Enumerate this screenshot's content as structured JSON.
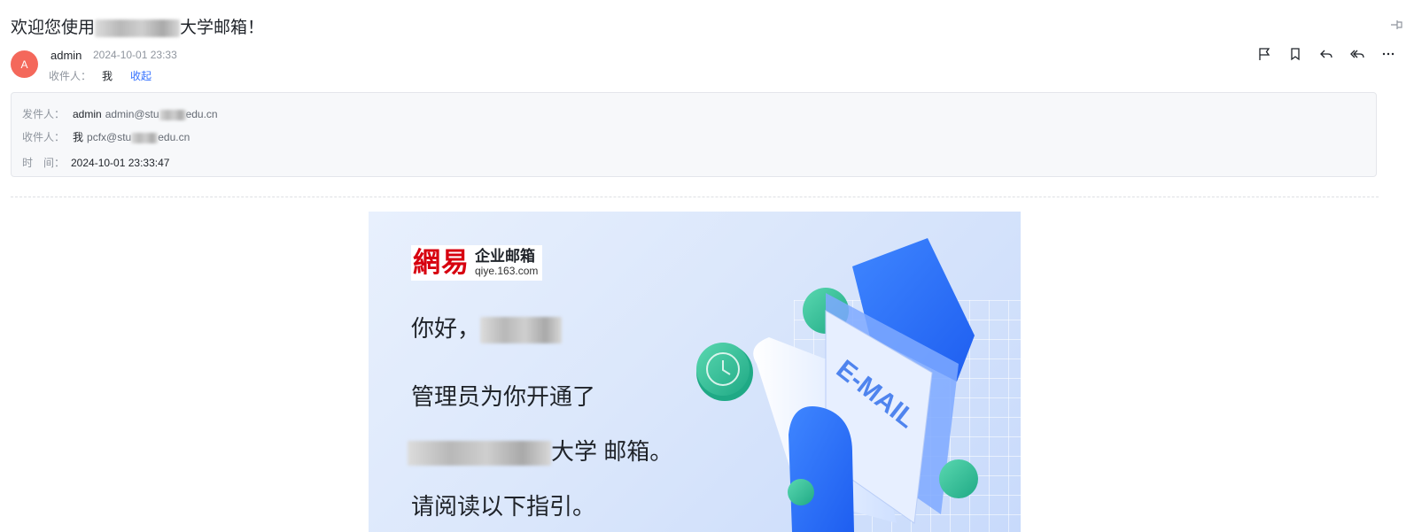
{
  "header": {
    "title_prefix": "欢迎您使用",
    "title_suffix": "大学邮箱！"
  },
  "sender": {
    "avatar_letter": "A",
    "name": "admin",
    "time": "2024-10-01 23:33",
    "recipient_label": "收件人：",
    "recipient": "我",
    "collapse_label": "收起"
  },
  "toolbar": {
    "icons": [
      "flag-icon",
      "bookmark-icon",
      "reply-icon",
      "reply-all-icon",
      "more-icon"
    ]
  },
  "details": {
    "from_label": "发件人：",
    "from_name": "admin",
    "from_addr_prefix": "admin@stu",
    "from_addr_suffix": "edu.cn",
    "to_label": "收件人：",
    "to_name": "我",
    "to_addr_prefix": "pcfx@stu",
    "to_addr_suffix": "edu.cn",
    "time_label": "时　间：",
    "time_value": "2024-10-01 23:33:47"
  },
  "banner": {
    "logo_cn": "網易",
    "logo_line1": "企业邮箱",
    "logo_line2": "qiye.163.com",
    "greeting": "你好，",
    "line1": "管理员为你开通了",
    "line2_suffix": "大学 邮箱。",
    "line3": "请阅读以下指引。",
    "illus_text": "E-MAIL"
  }
}
